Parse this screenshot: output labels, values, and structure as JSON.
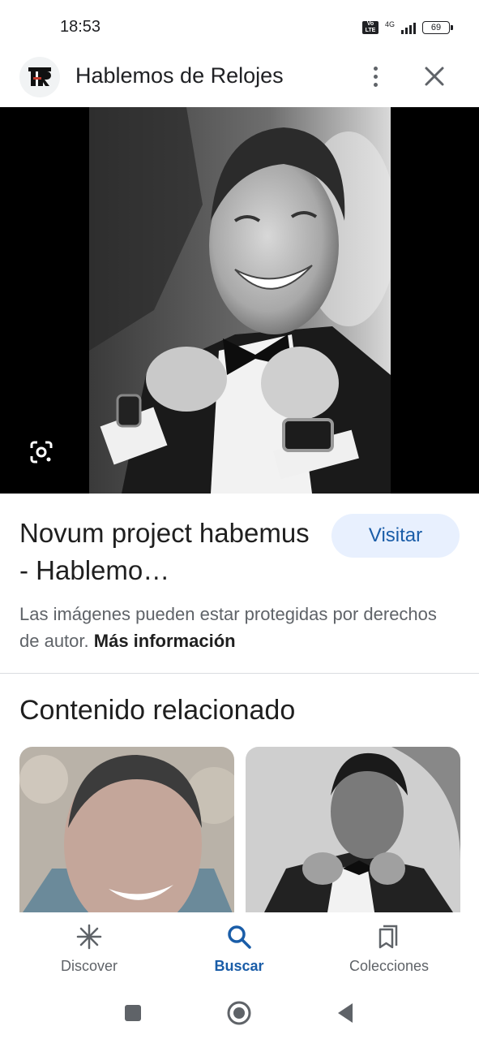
{
  "status_bar": {
    "time": "18:53",
    "volte_badge": "Vo LTE",
    "network": "4G",
    "battery": "69"
  },
  "header": {
    "site_name": "Hablemos de Relojes",
    "logo_icon": "hr-site-logo-icon",
    "more_icon": "more-vert-icon",
    "close_icon": "close-icon"
  },
  "hero": {
    "image_icon": "man-smiling-bowtie-photo",
    "lens_icon": "google-lens-icon"
  },
  "result": {
    "title": "Novum project habemus - Hablemo…",
    "visit_label": "Visitar",
    "copyright_text": "Las imágenes pueden estar protegidas por derechos de autor.",
    "more_info_label": "Más información"
  },
  "related": {
    "heading": "Contenido relacionado"
  },
  "bottom_nav": {
    "items": [
      {
        "label": "Discover",
        "icon": "discover-asterisk-icon"
      },
      {
        "label": "Buscar",
        "icon": "search-icon"
      },
      {
        "label": "Colecciones",
        "icon": "collections-bookmark-icon"
      }
    ],
    "active": "Buscar"
  },
  "colors": {
    "accent": "#1a5da8",
    "visit_bg": "#e8f0fe",
    "text_primary": "#1f1f1f",
    "text_secondary": "#5f6368"
  }
}
